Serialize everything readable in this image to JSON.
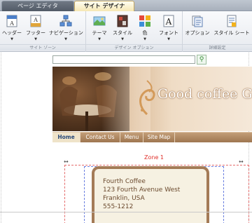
{
  "tabs": [
    "ページ エディタ",
    "サイト デザイナ"
  ],
  "ribbon": {
    "groups": [
      {
        "label": "サイト ゾーン",
        "buttons": [
          {
            "label": "ヘッダー",
            "icon": "header-icon"
          },
          {
            "label": "フッター",
            "icon": "footer-icon"
          },
          {
            "label": "ナビゲーション",
            "icon": "navigation-icon"
          }
        ]
      },
      {
        "label": "デザイン オプション",
        "buttons": [
          {
            "label": "テーマ",
            "icon": "theme-icon"
          },
          {
            "label": "スタイル",
            "icon": "style-icon"
          },
          {
            "label": "色",
            "icon": "color-icon"
          },
          {
            "label": "フォント",
            "icon": "font-icon"
          }
        ]
      },
      {
        "label": "詳細設定",
        "buttons": [
          {
            "label": "オプション",
            "icon": "options-icon"
          },
          {
            "label": "スタイル シート",
            "icon": "stylesheet-icon"
          }
        ]
      }
    ]
  },
  "page": {
    "banner_title": "Good coffee Gr",
    "nav": [
      "Home",
      "Contact Us",
      "Menu",
      "Site Map"
    ],
    "zone_label": "Zone 1",
    "address": [
      "Fourth Coffee",
      "123 Fourth Avenue West",
      "Franklin, USA",
      "555-1212"
    ]
  },
  "colors": {
    "active_tab": "#f6e7b4",
    "nav_bar": "#a98260",
    "zone_border": "#e46a6a",
    "zone_label": "#e0302a",
    "card_border": "#a47b57"
  }
}
